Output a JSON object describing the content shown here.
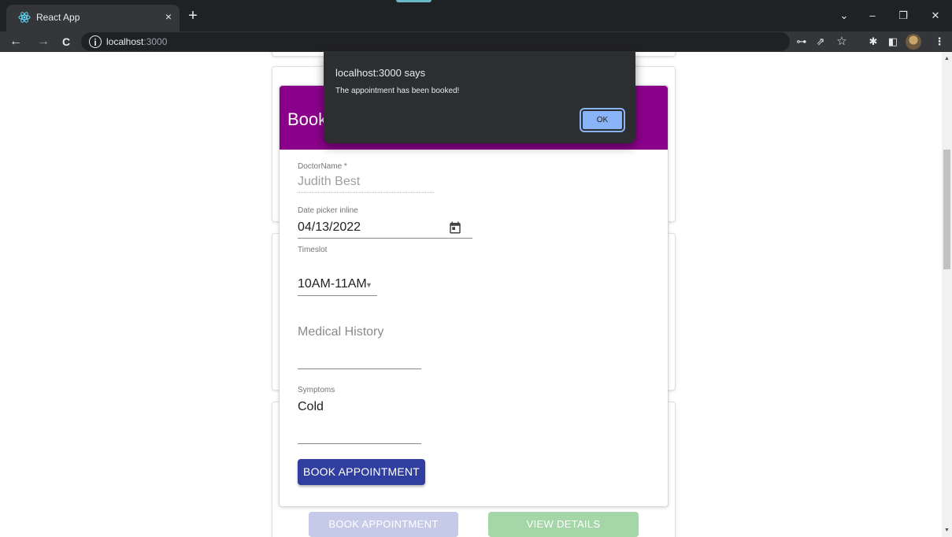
{
  "browser": {
    "tab_title": "React App",
    "tab_close": "×",
    "new_tab": "+",
    "url_host": "localhost",
    "url_port": ":3000",
    "icons": {
      "favicon": "react-icon",
      "back": "←",
      "forward": "→",
      "reload": "C",
      "info": "i",
      "key": "⊶",
      "share": "⇗",
      "star": "☆",
      "extensions": "✱",
      "sidepanel": "◧",
      "menu": "⋮",
      "tab_search": "⌄",
      "minimize": "–",
      "restore": "❐",
      "close": "✕"
    }
  },
  "dialog": {
    "title": "localhost:3000 says",
    "message": "The appointment has been booked!",
    "ok_label": "OK"
  },
  "form": {
    "header_title": "Book",
    "doctor_name_label": "DoctorName *",
    "doctor_name_value": "Judith Best",
    "date_label": "Date picker inline",
    "date_value": "04/13/2022",
    "timeslot_label": "Timeslot",
    "timeslot_value": "10AM-11AM",
    "medical_history_placeholder": "Medical History",
    "symptoms_label": "Symptoms",
    "symptoms_value": "Cold",
    "book_button": "BOOK APPOINTMENT"
  },
  "bottom_buttons": {
    "book_label": "BOOK APPOINTMENT",
    "view_label": "VIEW DETAILS"
  },
  "colors": {
    "header": "#8b008b",
    "primary": "#303f9f",
    "faded_book": "#c5cae9",
    "faded_view": "#a5d6a7",
    "dialog_bg": "#2d2e30",
    "ok_button": "#8ab4f8"
  }
}
